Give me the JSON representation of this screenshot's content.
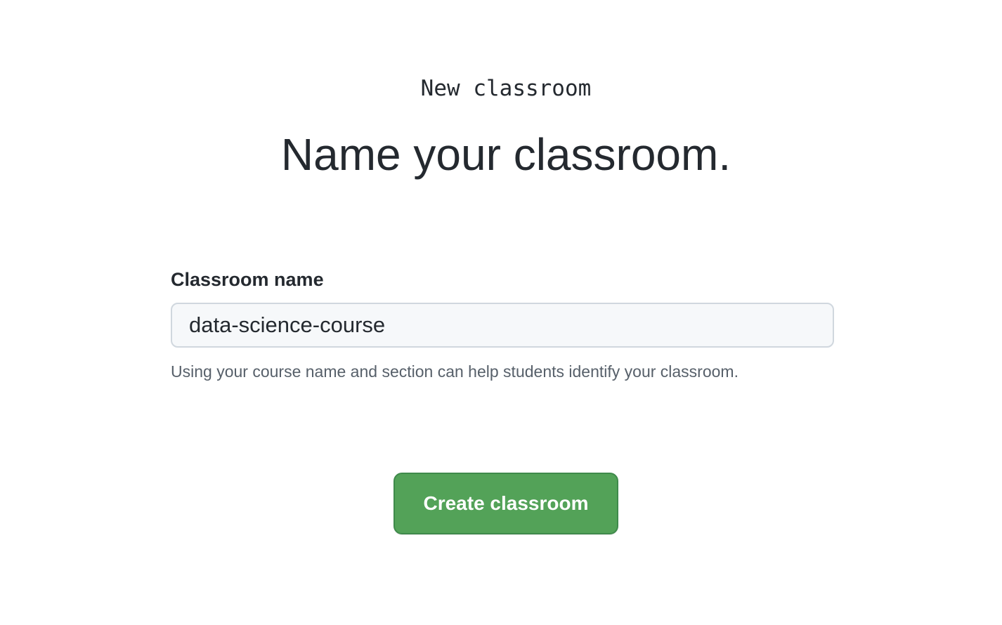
{
  "header": {
    "eyebrow": "New classroom",
    "title": "Name your classroom."
  },
  "form": {
    "name_label": "Classroom name",
    "name_value": "data-science-course",
    "hint": "Using your course name and section can help students identify your classroom."
  },
  "actions": {
    "create_label": "Create classroom"
  },
  "colors": {
    "primary_button": "#53a258",
    "text": "#24292f",
    "muted_text": "#57606a",
    "input_background": "#f6f8fa"
  }
}
